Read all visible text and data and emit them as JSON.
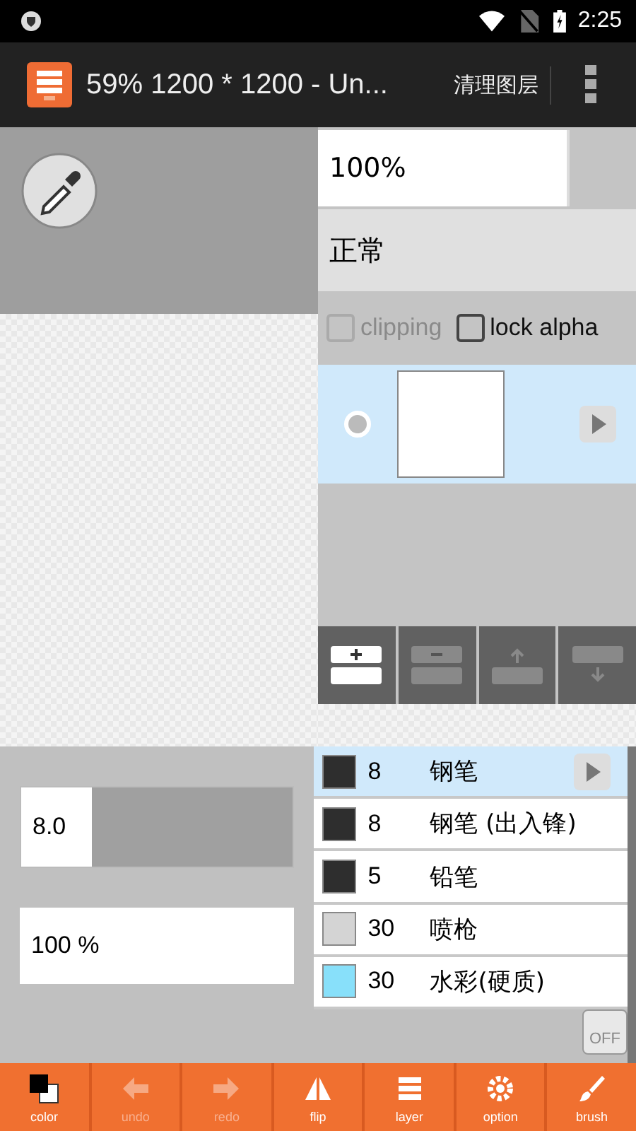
{
  "status_bar": {
    "time": "2:25"
  },
  "title_bar": {
    "title": "59% 1200 * 1200 - Un...",
    "action": "清理图层"
  },
  "layer_panel": {
    "opacity": "100%",
    "blend_mode": "正常",
    "options": [
      {
        "label": "clipping",
        "checked": false,
        "disabled": true
      },
      {
        "label": "lock alpha",
        "checked": false,
        "disabled": false
      }
    ],
    "layers": [
      {
        "selected": true
      }
    ],
    "buttons": [
      {
        "kind": "add",
        "disabled": false
      },
      {
        "kind": "remove",
        "disabled": true
      },
      {
        "kind": "up",
        "disabled": true
      },
      {
        "kind": "down",
        "disabled": true
      }
    ]
  },
  "brush_size": {
    "value": "8.0",
    "level": 0.16
  },
  "brush_opacity": {
    "value": "100 %"
  },
  "brushes": [
    {
      "size": "8",
      "name": "钢笔",
      "color": "#2e2e2e",
      "selected": true
    },
    {
      "size": "8",
      "name": "钢笔 (出入锋)",
      "color": "#2e2e2e",
      "selected": false
    },
    {
      "size": "5",
      "name": "铅笔",
      "color": "#2e2e2e",
      "selected": false
    },
    {
      "size": "30",
      "name": "喷枪",
      "color": "#d4d4d4",
      "selected": false
    },
    {
      "size": "30",
      "name": "水彩(硬质)",
      "color": "#88e0fa",
      "selected": false
    }
  ],
  "stabilizer": {
    "label": "OFF"
  },
  "toolbar": [
    {
      "label": "color",
      "kind": "color",
      "disabled": false
    },
    {
      "label": "undo",
      "kind": "undo",
      "disabled": true
    },
    {
      "label": "redo",
      "kind": "redo",
      "disabled": true
    },
    {
      "label": "flip",
      "kind": "flip",
      "disabled": false
    },
    {
      "label": "layer",
      "kind": "layer",
      "disabled": false
    },
    {
      "label": "option",
      "kind": "option",
      "disabled": false
    },
    {
      "label": "brush",
      "kind": "brush",
      "disabled": false
    }
  ]
}
